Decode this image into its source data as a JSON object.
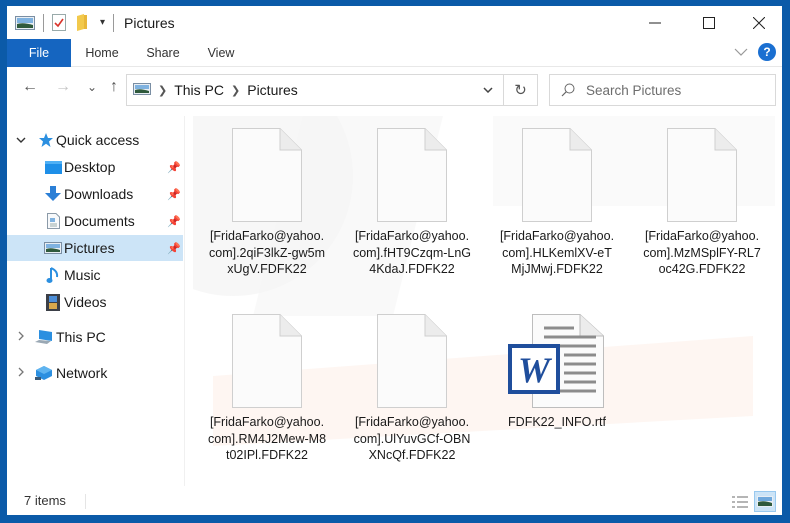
{
  "window": {
    "title": "Pictures",
    "controls": {
      "minimize": "minimize",
      "maximize": "maximize",
      "close": "close"
    }
  },
  "quick_access_toolbar": {
    "icons": [
      "pictures-icon",
      "properties-icon",
      "new-folder-icon",
      "customize-dropdown-icon"
    ]
  },
  "ribbon": {
    "tabs": [
      {
        "label": "File",
        "active": true
      },
      {
        "label": "Home"
      },
      {
        "label": "Share"
      },
      {
        "label": "View"
      }
    ],
    "help_label": "?"
  },
  "navigation": {
    "back_glyph": "←",
    "forward_glyph": "→",
    "recent_glyph": "⌄",
    "up_glyph": "↑",
    "breadcrumb": [
      "This PC",
      "Pictures"
    ],
    "refresh_glyph": "↻",
    "search": {
      "placeholder": "Search Pictures",
      "value": ""
    }
  },
  "sidebar": {
    "quick_access": {
      "label": "Quick access",
      "expanded": true
    },
    "items": [
      {
        "label": "Desktop",
        "icon": "desktop-icon",
        "pinned": true
      },
      {
        "label": "Downloads",
        "icon": "downloads-icon",
        "pinned": true
      },
      {
        "label": "Documents",
        "icon": "documents-icon",
        "pinned": true
      },
      {
        "label": "Pictures",
        "icon": "pictures-icon",
        "pinned": true,
        "selected": true
      },
      {
        "label": "Music",
        "icon": "music-icon",
        "pinned": false
      },
      {
        "label": "Videos",
        "icon": "videos-icon",
        "pinned": false
      }
    ],
    "this_pc": {
      "label": "This PC",
      "expanded": false
    },
    "network": {
      "label": "Network",
      "expanded": false
    }
  },
  "files": [
    {
      "name": "[FridaFarko@yahoo.com].2qiF3lkZ-gw5mxUgV.FDFK22",
      "type": "blank"
    },
    {
      "name": "[FridaFarko@yahoo.com].fHT9Czqm-LnG4KdaJ.FDFK22",
      "type": "blank"
    },
    {
      "name": "[FridaFarko@yahoo.com].HLKemlXV-eTMjJMwj.FDFK22",
      "type": "blank"
    },
    {
      "name": "[FridaFarko@yahoo.com].MzMSplFY-RL7oc42G.FDFK22",
      "type": "blank"
    },
    {
      "name": "[FridaFarko@yahoo.com].RM4J2Mew-M8t02IPl.FDFK22",
      "type": "blank"
    },
    {
      "name": "[FridaFarko@yahoo.com].UlYuvGCf-OBNXNcQf.FDFK22",
      "type": "blank"
    },
    {
      "name": "FDFK22_INFO.rtf",
      "type": "word"
    }
  ],
  "status_bar": {
    "item_count": "7 items",
    "views": [
      {
        "name": "details-view",
        "active": false
      },
      {
        "name": "large-icons-view",
        "active": true
      }
    ]
  },
  "colors": {
    "frame": "#0b5aa8",
    "file_tab": "#1565c0",
    "selection": "#cce4f7",
    "help": "#1a6fd1"
  }
}
